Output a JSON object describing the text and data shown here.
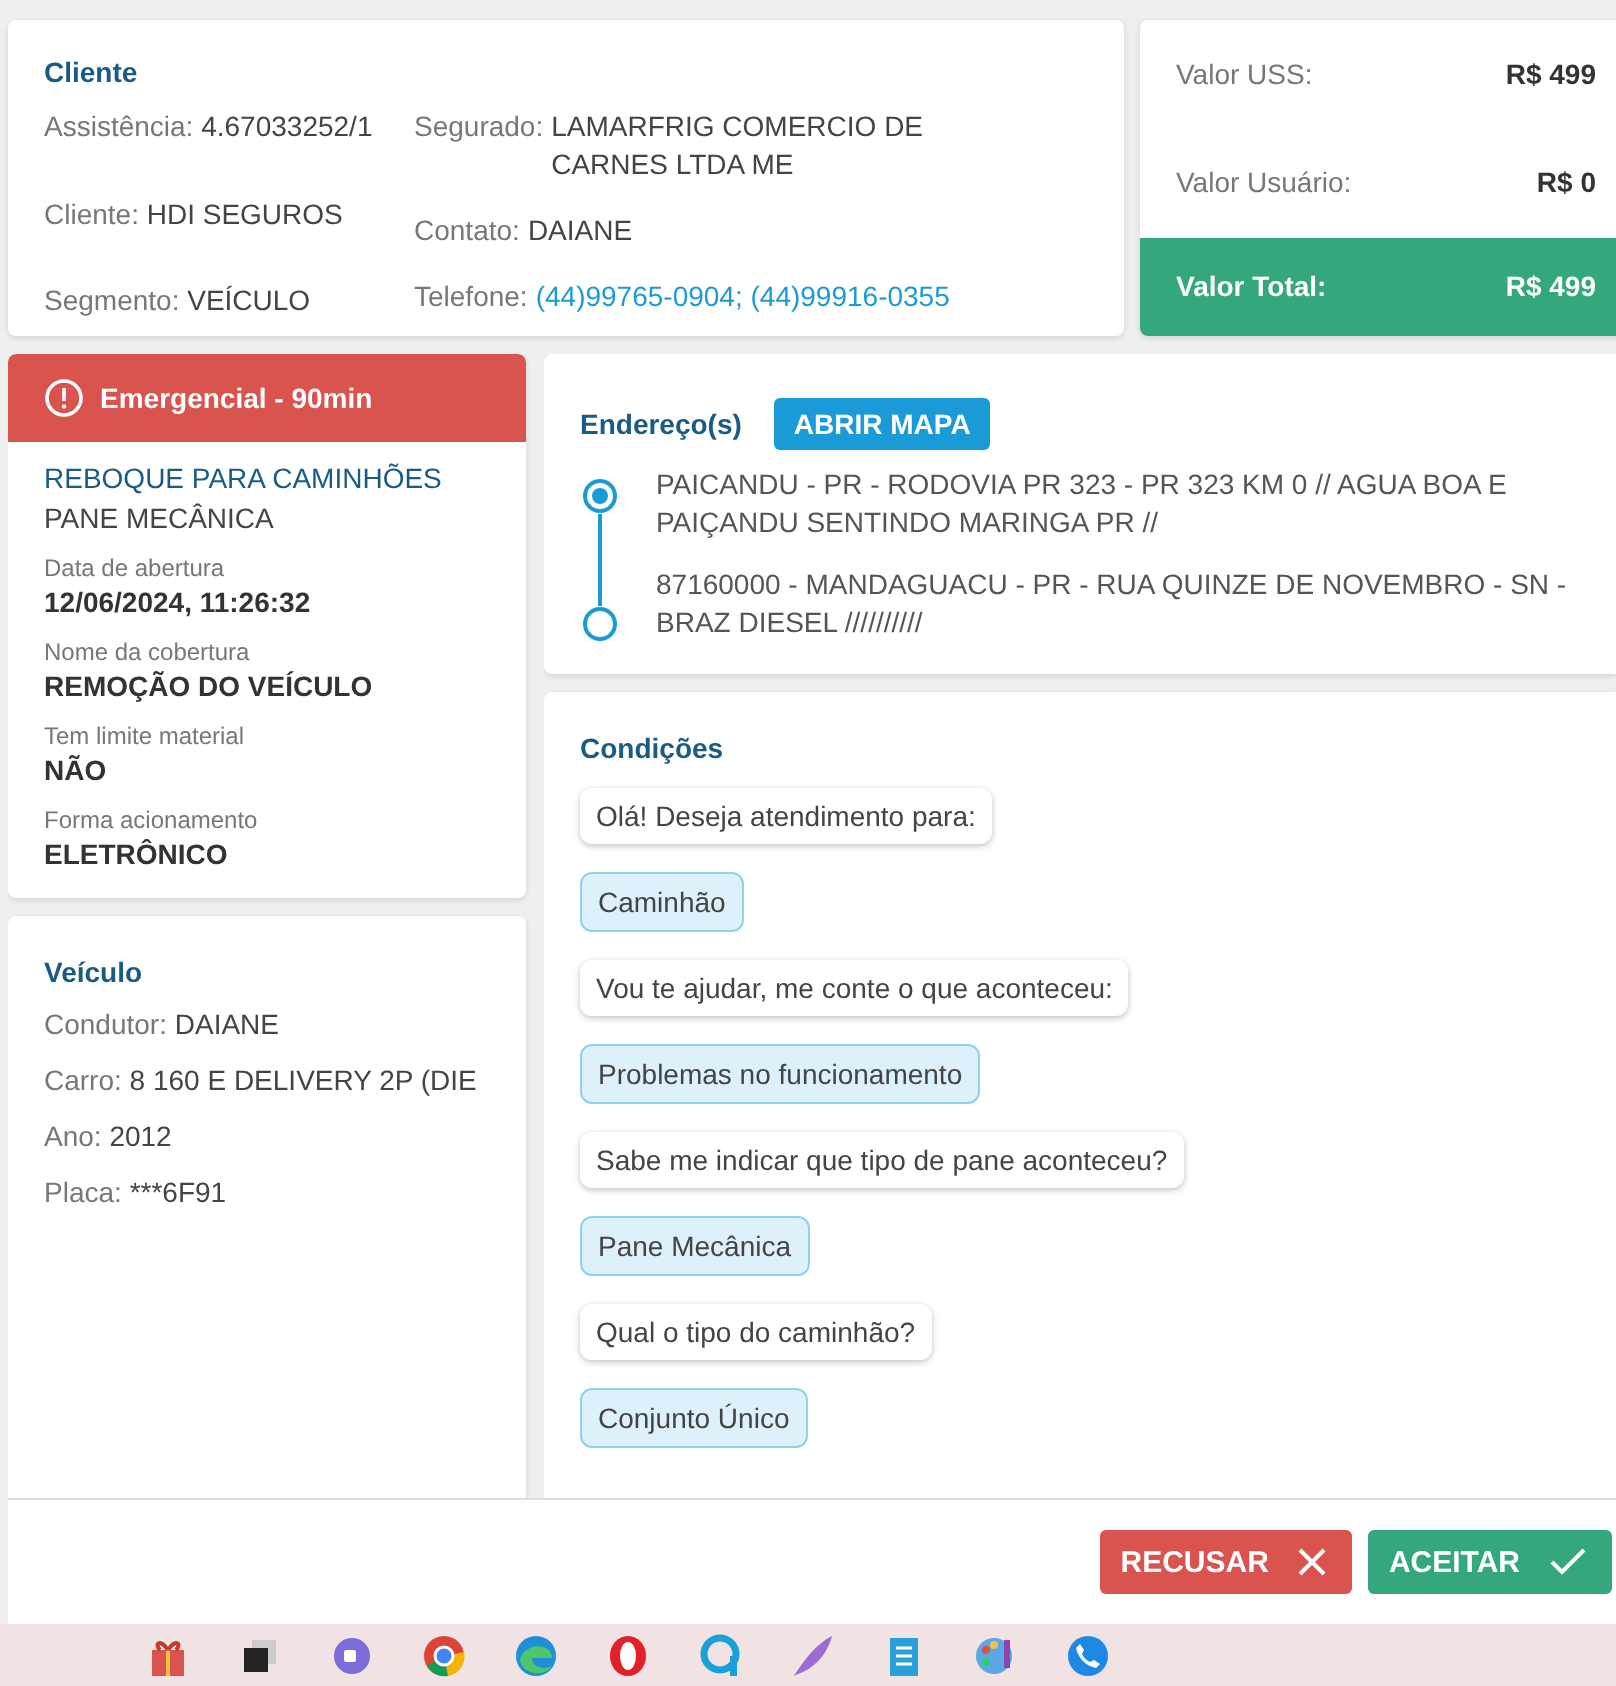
{
  "cliente": {
    "title": "Cliente",
    "fields_left": [
      {
        "label": "Assistência:",
        "value": "4.67033252/1"
      },
      {
        "label": "Cliente:",
        "value": "HDI SEGUROS"
      },
      {
        "label": "Segmento:",
        "value": "VEÍCULO"
      }
    ],
    "fields_right": [
      {
        "label": "Segurado:",
        "value": "LAMARFRIG COMERCIO DE CARNES LTDA ME",
        "kind": "text"
      },
      {
        "label": "Contato:",
        "value": "DAIANE",
        "kind": "text"
      },
      {
        "label": "Telefone:",
        "value": "(44)99765-0904; (44)99916-0355",
        "kind": "link"
      }
    ]
  },
  "valores": [
    {
      "label": "Valor USS:",
      "value": "R$ 499",
      "kind": "plain"
    },
    {
      "label": "Valor Usuário:",
      "value": "R$ 0",
      "kind": "plain"
    },
    {
      "label": "Valor Total:",
      "value": "R$ 499",
      "kind": "total"
    }
  ],
  "servico": {
    "banner": "Emergencial - 90min",
    "title": "REBOQUE PARA CAMINHÕES",
    "subtitle": "PANE MECÂNICA",
    "details": [
      {
        "label": "Data de abertura",
        "value": "12/06/2024, 11:26:32"
      },
      {
        "label": "Nome da cobertura",
        "value": "REMOÇÃO DO VEÍCULO"
      },
      {
        "label": "Tem limite material",
        "value": "NÃO"
      },
      {
        "label": "Forma acionamento",
        "value": "ELETRÔNICO"
      }
    ]
  },
  "veiculo": {
    "title": "Veículo",
    "fields": [
      {
        "label": "Condutor:",
        "value": "DAIANE"
      },
      {
        "label": "Carro:",
        "value": "8 160 E DELIVERY 2P (DIE"
      },
      {
        "label": "Ano:",
        "value": "2012"
      },
      {
        "label": "Placa:",
        "value": "***6F91"
      }
    ]
  },
  "enderecos": {
    "title": "Endereço(s)",
    "map_button": "ABRIR MAPA",
    "items": [
      {
        "kind": "origin",
        "text": "PAICANDU - PR - RODOVIA PR 323 - PR 323 KM 0 // AGUA BOA E PAIÇANDU SENTINDO MARINGA PR //"
      },
      {
        "kind": "destination",
        "text": "87160000 - MANDAGUACU - PR - RUA QUINZE DE NOVEMBRO - SN - BRAZ DIESEL //////////"
      }
    ]
  },
  "condicoes": {
    "title": "Condições",
    "messages": [
      {
        "kind": "question",
        "text": "Olá! Deseja atendimento para:"
      },
      {
        "kind": "answer",
        "text": "Caminhão"
      },
      {
        "kind": "question",
        "text": "Vou te ajudar, me conte o que aconteceu:"
      },
      {
        "kind": "answer",
        "text": "Problemas no funcionamento"
      },
      {
        "kind": "question",
        "text": "Sabe me indicar que tipo de pane aconteceu?"
      },
      {
        "kind": "answer",
        "text": "Pane Mecânica"
      },
      {
        "kind": "question",
        "text": "Qual o tipo do caminhão?"
      },
      {
        "kind": "answer",
        "text": "Conjunto Único"
      }
    ]
  },
  "actions": [
    {
      "kind": "refuse",
      "label": "RECUSAR"
    },
    {
      "kind": "accept",
      "label": "ACEITAR"
    }
  ]
}
